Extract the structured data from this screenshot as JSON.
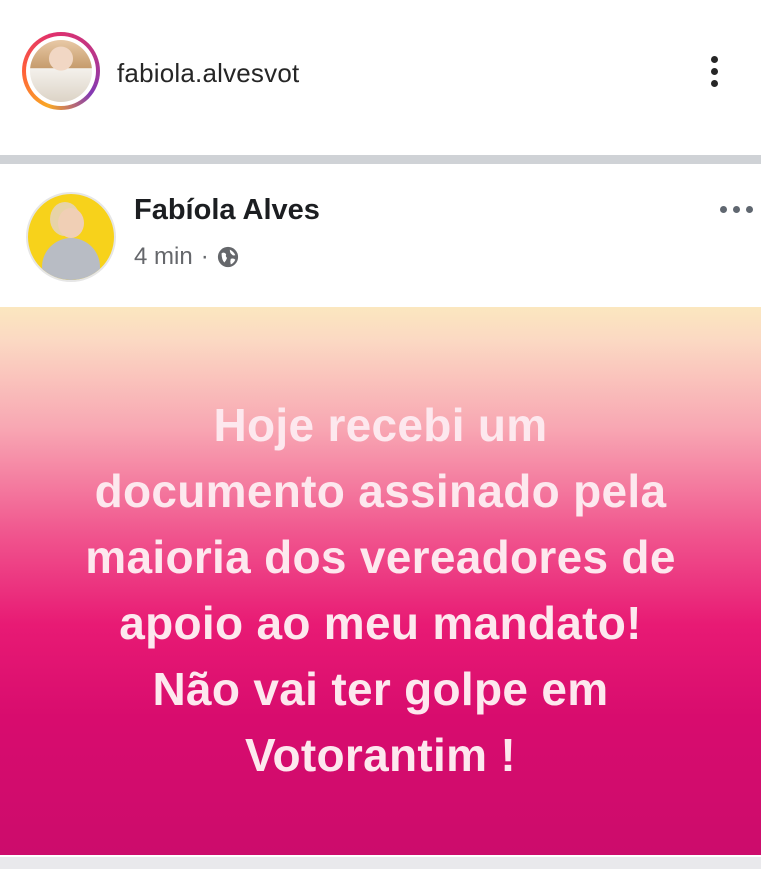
{
  "instagram": {
    "username": "fabiola.alvesvot",
    "icons": {
      "avatar": "profile-photo",
      "more": "vertical-ellipsis-icon"
    }
  },
  "facebook_post": {
    "author_name": "Fabíola Alves",
    "timestamp": "4 min",
    "separator": "·",
    "privacy_icon": "globe-icon",
    "more_icon": "horizontal-ellipsis-icon",
    "text_lines": [
      "Hoje recebi um",
      "documento assinado pela",
      "maioria dos vereadores de",
      "apoio ao meu mandato!",
      "Não vai ter golpe em",
      "Votorantim !"
    ],
    "colors": {
      "background_top": "#fbe7bf",
      "background_bottom": "#cc0c6c",
      "text": "#fde8ee"
    }
  }
}
